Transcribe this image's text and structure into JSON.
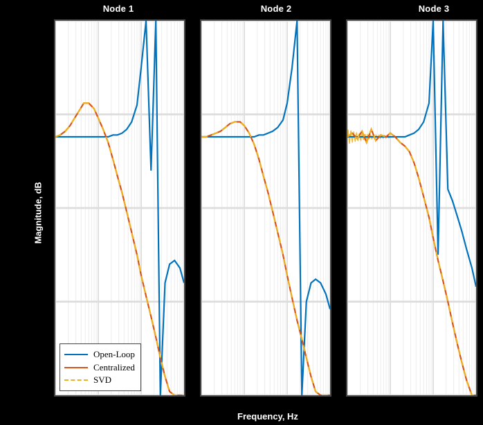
{
  "chart_data": [
    {
      "type": "line",
      "title": "Node 1",
      "xlabel": "Frequency, Hz",
      "ylabel": "Magnitude, dB",
      "xscale": "log",
      "x": [
        1,
        1.3,
        1.7,
        2.2,
        2.8,
        3.6,
        4.6,
        6,
        8,
        10,
        13,
        17,
        22,
        28,
        36,
        46,
        60,
        80,
        100,
        130,
        170,
        220,
        280,
        360,
        460,
        600,
        800,
        1000
      ],
      "xlim": [
        1,
        1000
      ],
      "ylim": [
        -150,
        50
      ],
      "grid": true,
      "legend_position": "lower left",
      "series": [
        {
          "name": "Open-Loop",
          "color": "#0072BD",
          "values": [
            -12,
            -12,
            -12,
            -12,
            -12,
            -12,
            -12,
            -12,
            -12,
            -12,
            -12,
            -12,
            -11,
            -11,
            -10,
            -8,
            -4,
            5,
            25,
            50,
            -30,
            50,
            -150,
            -90,
            -80,
            -78,
            -82,
            -90
          ]
        },
        {
          "name": "Centralized",
          "color": "#D95319",
          "values": [
            -12,
            -11,
            -9,
            -6,
            -2,
            2,
            6,
            6,
            3,
            -2,
            -8,
            -15,
            -24,
            -33,
            -42,
            -52,
            -63,
            -75,
            -86,
            -97,
            -108,
            -119,
            -130,
            -140,
            -148,
            -150,
            -150,
            -150
          ]
        },
        {
          "name": "SVD",
          "color": "#EDB120",
          "style": "dashed",
          "values": [
            -12,
            -11,
            -9,
            -6,
            -2,
            2,
            6,
            6,
            3,
            -2,
            -8,
            -15,
            -24,
            -33,
            -42,
            -52,
            -63,
            -75,
            -86,
            -97,
            -108,
            -119,
            -130,
            -140,
            -148,
            -150,
            -150,
            -150
          ]
        }
      ]
    },
    {
      "type": "line",
      "title": "Node 2",
      "xlabel": "Frequency, Hz",
      "ylabel": "Magnitude, dB",
      "xscale": "log",
      "x": [
        1,
        1.3,
        1.7,
        2.2,
        2.8,
        3.6,
        4.6,
        6,
        8,
        10,
        13,
        17,
        22,
        28,
        36,
        46,
        60,
        80,
        100,
        130,
        170,
        220,
        280,
        360,
        460,
        600,
        800,
        1000
      ],
      "xlim": [
        1,
        1000
      ],
      "ylim": [
        -150,
        50
      ],
      "grid": true,
      "series": [
        {
          "name": "Open-Loop",
          "color": "#0072BD",
          "values": [
            -12,
            -12,
            -12,
            -12,
            -12,
            -12,
            -12,
            -12,
            -12,
            -12,
            -12,
            -12,
            -11,
            -11,
            -10,
            -9,
            -7,
            -3,
            6,
            25,
            50,
            -150,
            -100,
            -90,
            -88,
            -90,
            -96,
            -104
          ]
        },
        {
          "name": "Centralized",
          "color": "#D95319",
          "values": [
            -12,
            -12,
            -11,
            -10,
            -9,
            -7,
            -5,
            -4,
            -4,
            -6,
            -10,
            -16,
            -24,
            -33,
            -42,
            -52,
            -63,
            -75,
            -86,
            -98,
            -110,
            -120,
            -130,
            -140,
            -148,
            -150,
            -150,
            -150
          ]
        },
        {
          "name": "SVD",
          "color": "#EDB120",
          "style": "dashed",
          "values": [
            -12,
            -12,
            -11,
            -10,
            -9,
            -7,
            -5,
            -4,
            -4,
            -6,
            -10,
            -16,
            -24,
            -33,
            -42,
            -52,
            -63,
            -75,
            -86,
            -98,
            -110,
            -120,
            -130,
            -140,
            -148,
            -150,
            -150,
            -150
          ]
        }
      ]
    },
    {
      "type": "line",
      "title": "Node 3",
      "xlabel": "Frequency, Hz",
      "ylabel": "Magnitude, dB",
      "xscale": "log",
      "x": [
        1,
        1.3,
        1.7,
        2.2,
        2.8,
        3.6,
        4.6,
        6,
        8,
        10,
        13,
        17,
        22,
        28,
        36,
        46,
        60,
        80,
        100,
        130,
        170,
        220,
        280,
        360,
        460,
        600,
        800,
        1000
      ],
      "xlim": [
        1,
        1000
      ],
      "ylim": [
        -150,
        50
      ],
      "grid": true,
      "series": [
        {
          "name": "Open-Loop",
          "color": "#0072BD",
          "values": [
            -12,
            -12,
            -12,
            -12,
            -12,
            -12,
            -12,
            -12,
            -12,
            -12,
            -12,
            -12,
            -12,
            -11,
            -10,
            -8,
            -4,
            6,
            50,
            -75,
            50,
            -40,
            -46,
            -54,
            -62,
            -72,
            -82,
            -92
          ]
        },
        {
          "name": "Centralized",
          "color": "#D95319",
          "values": [
            -12,
            -10,
            -13,
            -9,
            -15,
            -8,
            -14,
            -11,
            -12,
            -10,
            -12,
            -15,
            -17,
            -20,
            -26,
            -34,
            -44,
            -55,
            -66,
            -78,
            -89,
            -100,
            -111,
            -122,
            -132,
            -142,
            -150,
            -150
          ]
        },
        {
          "name": "SVD",
          "color": "#EDB120",
          "style": "dashed",
          "values": [
            -12,
            -10,
            -13,
            -9,
            -15,
            -8,
            -14,
            -11,
            -12,
            -10,
            -12,
            -15,
            -17,
            -20,
            -26,
            -34,
            -44,
            -55,
            -66,
            -78,
            -89,
            -100,
            -111,
            -122,
            -132,
            -142,
            -150,
            -150
          ]
        }
      ],
      "notes": "SVD/Centralized low-frequency region shows rapid oscillatory ripple (~1-10 Hz) of roughly ±3 dB before smoothing out."
    }
  ],
  "ylabel": "Magnitude, dB",
  "xlabel": "Frequency, Hz",
  "titles": [
    "Node 1",
    "Node 2",
    "Node 3"
  ],
  "legend": {
    "open": "Open-Loop",
    "cen": "Centralized",
    "svd": "SVD"
  },
  "colors": {
    "open": "#0072BD",
    "cen": "#D95319",
    "svd": "#EDB120"
  }
}
